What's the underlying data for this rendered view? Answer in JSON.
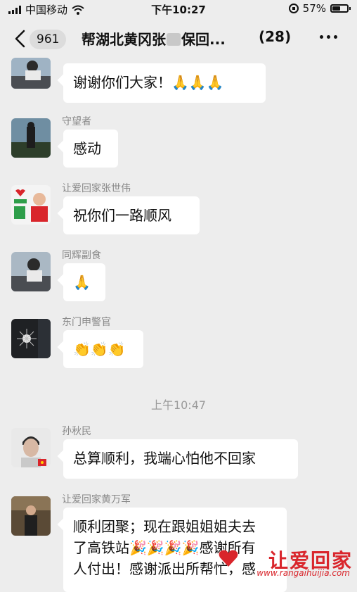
{
  "status_bar": {
    "carrier": "中国移动",
    "time": "下午10:27",
    "battery_percent": "57%",
    "battery_level": 0.57
  },
  "nav": {
    "unread_count": "961",
    "title_part1": "帮湖北黄冈张",
    "title_part2": "保回...",
    "member_count": "(28)"
  },
  "messages": [
    {
      "sender": "",
      "text": "谢谢你们大家！🙏🙏🙏",
      "avatar": "avatar-driver"
    },
    {
      "sender": "守望者",
      "text": "感动",
      "avatar": "avatar-silhouette"
    },
    {
      "sender": "让爱回家张世伟",
      "text": "祝你们一路顺风",
      "avatar": "avatar-volunteer"
    },
    {
      "sender": "同辉副食",
      "text": "🙏",
      "avatar": "avatar-driver"
    },
    {
      "sender": "东门申警官",
      "text": "👏👏👏",
      "avatar": "avatar-lamp"
    },
    {
      "sender": "孙秋民",
      "text": "总算顺利，我端心怕他不回家",
      "avatar": "avatar-portrait"
    },
    {
      "sender": "让爱回家黄万军",
      "text_line1": "顺利团聚；现在跟姐姐姐夫去",
      "text_line2": "了高铁站🎉🎉🎉🎉感谢所有",
      "text_line3": "人付出！感谢派出所帮忙，感",
      "avatar": "avatar-man"
    }
  ],
  "time_separator": "上午10:47",
  "watermark": {
    "brand": "让爱回家",
    "url": "www.rangaihuijia.com"
  },
  "colors": {
    "background": "#ededed",
    "bubble": "#ffffff",
    "brand_red": "#d9252b"
  }
}
